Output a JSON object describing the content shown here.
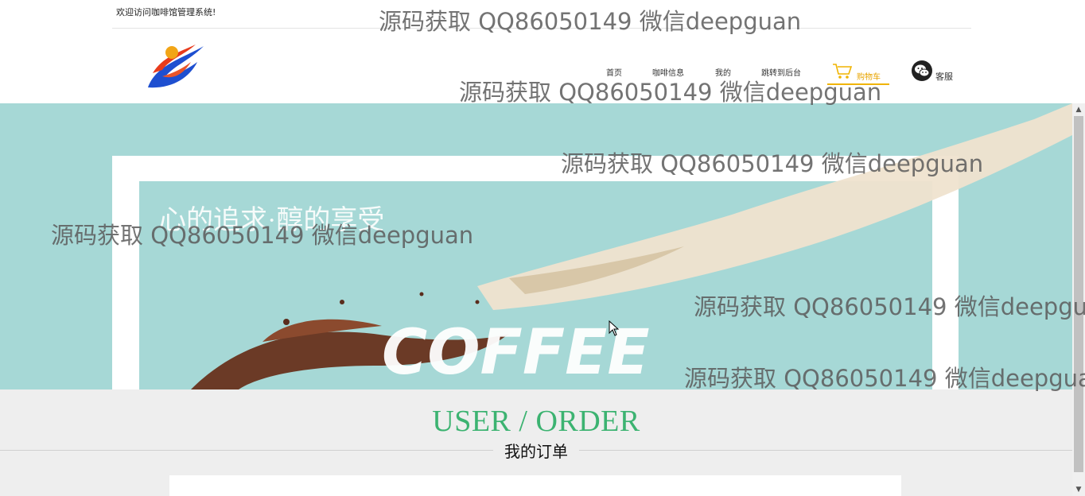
{
  "topbar": {
    "welcome": "欢迎访问咖啡馆管理系统!"
  },
  "nav": {
    "items": [
      {
        "label": "首页"
      },
      {
        "label": "咖啡信息"
      },
      {
        "label": "我的"
      },
      {
        "label": "跳转到后台"
      }
    ],
    "cart_label": "购物车",
    "service_label": "客服"
  },
  "banner": {
    "tagline": "心的追求·醇的享受",
    "word": "COFFEE"
  },
  "section": {
    "title": "USER / ORDER",
    "subtitle": "我的订单"
  },
  "watermark": {
    "text": "源码获取 QQ86050149 微信deepguan"
  },
  "colors": {
    "accent": "#3cb371",
    "cart": "#f0b400",
    "banner_bg": "#a6d8d6",
    "section_bg": "#eeeeee"
  },
  "icons": {
    "cart": "cart-icon",
    "service": "wechat-icon",
    "logo": "logo-icon"
  }
}
